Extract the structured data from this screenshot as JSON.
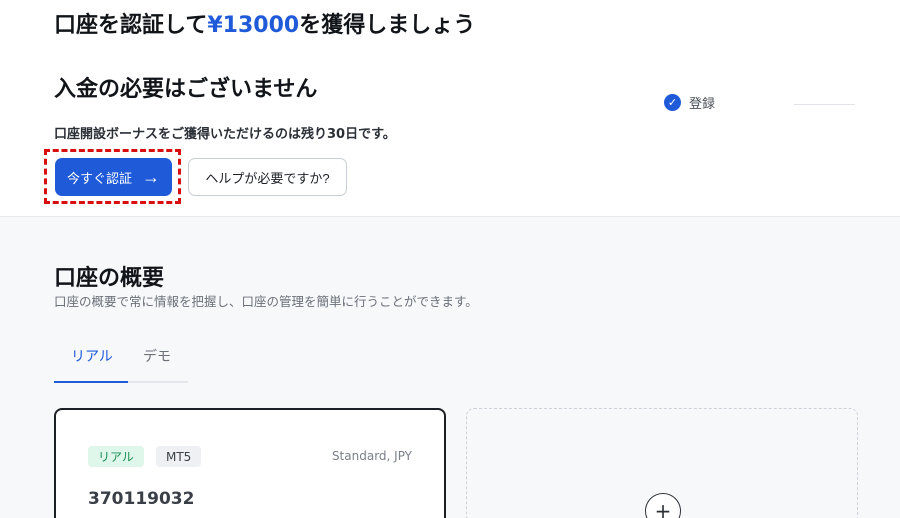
{
  "hero": {
    "headline_prefix": "口座を認証して",
    "headline_amount": "¥13000",
    "headline_suffix": "を獲得しましょう",
    "headline_line2": "入金の必要はございません",
    "subline": "口座開設ボーナスをご獲得いただけるのは残り30日です。",
    "verify_button_label": "今すぐ認証",
    "verify_button_arrow": "→",
    "help_button_label": "ヘルプが必要ですか?",
    "step_label": "登録",
    "step_check": "✓"
  },
  "overview": {
    "title": "口座の概要",
    "description": "口座の概要で常に情報を把握し、口座の管理を簡単に行うことができます。",
    "tabs": [
      {
        "label": "リアル",
        "active": true
      },
      {
        "label": "デモ",
        "active": false
      }
    ]
  },
  "account_card": {
    "badge_real": "リアル",
    "badge_platform": "MT5",
    "account_type": "Standard, JPY",
    "account_number": "370119032"
  },
  "add_card": {
    "plus_symbol": "+"
  },
  "colors": {
    "accent": "#1f5bd8",
    "highlight": "#d90f0f"
  }
}
